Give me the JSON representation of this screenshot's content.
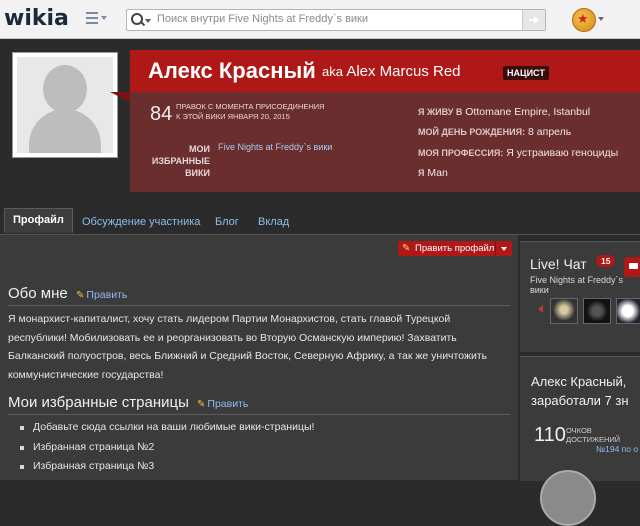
{
  "topbar": {
    "logo": "wikia",
    "search_placeholder": "Поиск внутри Five Nights at Freddy`s вики"
  },
  "profile": {
    "name": "Алекс Красный",
    "aka_word": "aka",
    "aka_name": "Alex Marcus Red",
    "tag": "НАЦИСТ",
    "edit_count": "84",
    "edit_label": "правок с момента присоединения к этой вики января 20, 2015",
    "fav_wikis_label": "МОИ ИЗБРАННЫЕ ВИКИ",
    "fav_wiki": "Five Nights at Freddy`s вики",
    "info": [
      {
        "label": "Я ЖИВУ В",
        "value": "Ottomane Empire, Istanbul"
      },
      {
        "label": "МОЙ ДЕНЬ РОЖДЕНИЯ:",
        "value": "8 апрель"
      },
      {
        "label": "МОЯ ПРОФЕССИЯ:",
        "value": "Я устраиваю геноциды"
      },
      {
        "label": "Я",
        "value": "Man"
      }
    ]
  },
  "tabs": [
    "Профайл",
    "Обсуждение участника",
    "Блог",
    "Вклад"
  ],
  "edit_profile_label": "Править профайл",
  "about": {
    "title": "Обо мне",
    "edit_label": "Править",
    "text": "Я монархист-капиталист, хочу стать лидером Партии Монархистов, стать главой Турецкой республики! Мобилизовать ее и реорганизовать во Вторую Османскую империю! Захватить Балканский полуостров, весь Ближний и Средний Восток, Северную Африку, а так же уничтожить коммунистические государства!"
  },
  "favorites": {
    "title": "Мои избранные страницы",
    "edit_label": "Править",
    "items": [
      "Добавьте сюда ссылки на ваши любимые вики-страницы!",
      "Избранная страница №2",
      "Избранная страница №3"
    ]
  },
  "chat": {
    "title": "Live! Чат",
    "count": "15",
    "wiki": "Five Nights at Freddy`s вики"
  },
  "achievements": {
    "name_line1": "Алекс Красный, ",
    "name_line2": "заработали 7 зн",
    "count": "110",
    "label": "очков достижений",
    "rank": "№194 по о"
  },
  "colors": {
    "accent_red": "#b01818",
    "panel_dark_red": "#6b2e2e",
    "link_blue": "#8fbcf0",
    "background": "#2b2b2b"
  }
}
